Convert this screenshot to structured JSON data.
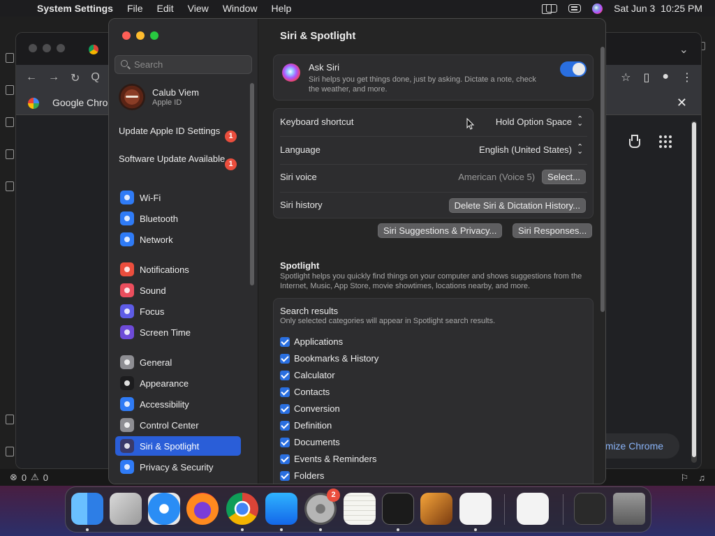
{
  "menubar": {
    "app_name": "System Settings",
    "items": [
      "File",
      "Edit",
      "View",
      "Window",
      "Help"
    ],
    "datetime": "Sat Jun 3  10:25 PM",
    "status_icons": [
      "window-icon",
      "search-icon",
      "control-center-icon",
      "siri-icon"
    ]
  },
  "vscode": {
    "status_problems": "0",
    "status_warnings": "0"
  },
  "chrome": {
    "bookmark": "Google Chrome",
    "customize_label": "omize Chrome",
    "search_glyph": "Q"
  },
  "settings": {
    "search_placeholder": "Search",
    "profile": {
      "name": "Calub Viem",
      "subtitle": "Apple ID"
    },
    "notices": [
      {
        "label": "Update Apple ID Settings",
        "badge": "1"
      },
      {
        "label": "Software Update Available",
        "badge": "1"
      }
    ],
    "sidebar": {
      "group1": [
        {
          "label": "Wi-Fi",
          "icon": "wifi-icon",
          "color": "#2f7bf6"
        },
        {
          "label": "Bluetooth",
          "icon": "bluetooth-icon",
          "color": "#2f7bf6"
        },
        {
          "label": "Network",
          "icon": "network-icon",
          "color": "#2f7bf6"
        }
      ],
      "group2": [
        {
          "label": "Notifications",
          "icon": "notifications-icon",
          "color": "#eb4e3d"
        },
        {
          "label": "Sound",
          "icon": "sound-icon",
          "color": "#eb4e5d"
        },
        {
          "label": "Focus",
          "icon": "focus-icon",
          "color": "#5e5ce6"
        },
        {
          "label": "Screen Time",
          "icon": "screen-time-icon",
          "color": "#6e4bd8"
        }
      ],
      "group3": [
        {
          "label": "General",
          "icon": "gear-icon",
          "color": "#8e8e93"
        },
        {
          "label": "Appearance",
          "icon": "appearance-icon",
          "color": "#1c1c1e"
        },
        {
          "label": "Accessibility",
          "icon": "accessibility-icon",
          "color": "#2f7bf6"
        },
        {
          "label": "Control Center",
          "icon": "control-center-icon",
          "color": "#8e8e93"
        },
        {
          "label": "Siri & Spotlight",
          "icon": "siri-icon",
          "color": "#3a3a6a"
        },
        {
          "label": "Privacy & Security",
          "icon": "hand-icon",
          "color": "#2f7bf6"
        }
      ]
    },
    "main": {
      "title": "Siri & Spotlight",
      "ask_siri": {
        "title": "Ask Siri",
        "description": "Siri helps you get things done, just by asking. Dictate a note, check the weather, and more.",
        "enabled": true
      },
      "rows": {
        "keyboard_shortcut": {
          "label": "Keyboard shortcut",
          "value": "Hold Option Space"
        },
        "language": {
          "label": "Language",
          "value": "English (United States)"
        },
        "siri_voice": {
          "label": "Siri voice",
          "value": "American (Voice 5)",
          "button": "Select..."
        },
        "siri_history": {
          "label": "Siri history",
          "button": "Delete Siri & Dictation History..."
        }
      },
      "buttons": {
        "suggestions": "Siri Suggestions & Privacy...",
        "responses": "Siri Responses..."
      },
      "spotlight": {
        "title": "Spotlight",
        "description": "Spotlight helps you quickly find things on your computer and shows suggestions from the Internet, Music, App Store, movie showtimes, locations nearby, and more."
      },
      "search_results": {
        "title": "Search results",
        "description": "Only selected categories will appear in Spotlight search results.",
        "items": [
          "Applications",
          "Bookmarks & History",
          "Calculator",
          "Contacts",
          "Conversion",
          "Definition",
          "Documents",
          "Events & Reminders",
          "Folders"
        ]
      }
    }
  },
  "dock": {
    "apps": [
      "finder-icon",
      "launchpad-icon",
      "safari-icon",
      "firefox-icon",
      "chrome-icon",
      "app-store-icon",
      "system-settings-icon",
      "textedit-icon",
      "terminal-icon",
      "garageband-icon",
      "vscode-icon",
      "visual-studio-icon",
      "preview-window-icon",
      "trash-icon"
    ],
    "settings_badge": "2"
  }
}
